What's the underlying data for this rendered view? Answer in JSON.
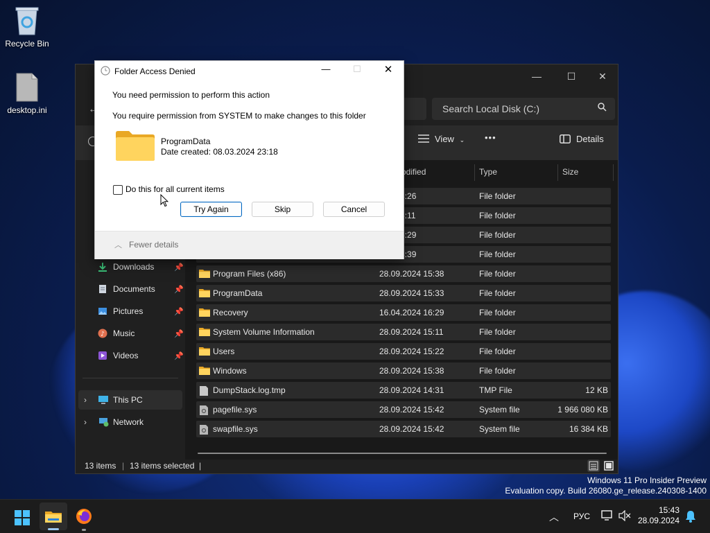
{
  "desktop": {
    "icons": [
      {
        "label": "Recycle Bin"
      },
      {
        "label": "desktop.ini"
      }
    ],
    "watermark": {
      "line1": "Windows 11 Pro Insider Preview",
      "line2": "Evaluation copy. Build 26080.ge_release.240308-1400"
    }
  },
  "explorer": {
    "search_placeholder": "Search Local Disk (C:)",
    "toolbar": {
      "view_label": "View",
      "more_label": "•••",
      "details_label": "Details"
    },
    "columns": {
      "modified": "odified",
      "type": "Type",
      "size": "Size"
    },
    "rows": [
      {
        "name": "",
        "date": "024 13:26",
        "type": "File folder",
        "size": "",
        "icon": "folder-icon"
      },
      {
        "name": "",
        "date": "024 15:11",
        "type": "File folder",
        "size": "",
        "icon": "folder-icon"
      },
      {
        "name": "",
        "date": "024 16:29",
        "type": "File folder",
        "size": "",
        "icon": "folder-icon"
      },
      {
        "name": "",
        "date": "024 15:39",
        "type": "File folder",
        "size": "",
        "icon": "folder-icon"
      },
      {
        "name": "Program Files (x86)",
        "date": "28.09.2024 15:38",
        "type": "File folder",
        "size": "",
        "icon": "folder-icon"
      },
      {
        "name": "ProgramData",
        "date": "28.09.2024 15:33",
        "type": "File folder",
        "size": "",
        "icon": "folder-icon"
      },
      {
        "name": "Recovery",
        "date": "16.04.2024 16:29",
        "type": "File folder",
        "size": "",
        "icon": "folder-icon"
      },
      {
        "name": "System Volume Information",
        "date": "28.09.2024 15:11",
        "type": "File folder",
        "size": "",
        "icon": "folder-icon"
      },
      {
        "name": "Users",
        "date": "28.09.2024 15:22",
        "type": "File folder",
        "size": "",
        "icon": "folder-icon"
      },
      {
        "name": "Windows",
        "date": "28.09.2024 15:38",
        "type": "File folder",
        "size": "",
        "icon": "folder-icon"
      },
      {
        "name": "DumpStack.log.tmp",
        "date": "28.09.2024 14:31",
        "type": "TMP File",
        "size": "12 KB",
        "icon": "file-icon"
      },
      {
        "name": "pagefile.sys",
        "date": "28.09.2024 15:42",
        "type": "System file",
        "size": "1 966 080 KB",
        "icon": "system-file-icon"
      },
      {
        "name": "swapfile.sys",
        "date": "28.09.2024 15:42",
        "type": "System file",
        "size": "16 384 KB",
        "icon": "system-file-icon"
      }
    ],
    "nav": {
      "quick": [
        {
          "label": "Downloads",
          "icon": "download-icon"
        },
        {
          "label": "Documents",
          "icon": "documents-icon"
        },
        {
          "label": "Pictures",
          "icon": "pictures-icon"
        },
        {
          "label": "Music",
          "icon": "music-icon"
        },
        {
          "label": "Videos",
          "icon": "videos-icon"
        }
      ],
      "this_pc": "This PC",
      "network": "Network"
    },
    "status": {
      "items": "13 items",
      "selected": "13 items selected"
    }
  },
  "dialog": {
    "title": "Folder Access Denied",
    "heading": "You need permission to perform this action",
    "message": "You require permission from SYSTEM to make changes to this folder",
    "item_name": "ProgramData",
    "item_date": "Date created: 08.03.2024 23:18",
    "checkbox_label": "Do this for all current items",
    "try_again": "Try Again",
    "skip": "Skip",
    "cancel": "Cancel",
    "fewer_details": "Fewer details"
  },
  "taskbar": {
    "language": "РУС",
    "time": "15:43",
    "date": "28.09.2024"
  },
  "colors": {
    "accent": "#0067c0",
    "folder": "#f5c13d",
    "window_bg": "#202020",
    "row_bg": "#2b2b2b"
  }
}
